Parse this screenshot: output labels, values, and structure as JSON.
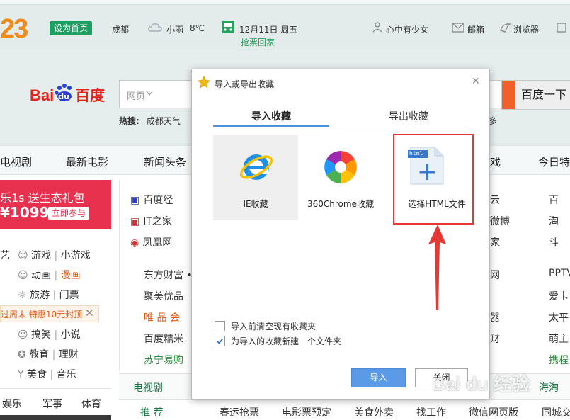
{
  "top": {
    "logo": "23",
    "set_homepage": "设为首页",
    "city": "成都",
    "weather": "小雨",
    "temp": "8℃",
    "date": "12月11日 周五",
    "ticket": "抢票回家",
    "user": "心中有少女",
    "mail": "邮箱",
    "browser": "浏览器"
  },
  "search": {
    "engine_bai": "Bai",
    "engine_du": "du",
    "engine_name": "百度",
    "type": "网页",
    "button": "百度一下",
    "hot_label": "热搜:",
    "hot_item": "成都天气",
    "hot_more": "多"
  },
  "nav": [
    "电视剧",
    "最新电影",
    "新闻头条",
    "戏",
    "今日特"
  ],
  "promo": {
    "line1": "乐1s 送生态礼包",
    "price": "¥1099",
    "cta": "立即参与"
  },
  "left": {
    "items": [
      {
        "a": "游戏",
        "b": "小游戏"
      },
      {
        "a": "动画",
        "b": "漫画"
      },
      {
        "a": "旅游",
        "b": "门票"
      },
      {
        "a": "搞笑",
        "b": "小说"
      },
      {
        "a": "教育",
        "b": "理财"
      },
      {
        "a": "美食",
        "b": "音乐"
      }
    ],
    "notice": "过周末 特惠10元封顶",
    "tabs": [
      "娱乐",
      "军事",
      "体育"
    ],
    "fragment": "艺"
  },
  "sites": {
    "left": [
      "百度经",
      "IT之家",
      "凤凰网",
      "东方财富 •",
      "聚美优品",
      "唯 品 会",
      "百度糯米",
      "苏宁易购"
    ],
    "mid": [
      "云",
      "微博",
      "家",
      "网",
      "器",
      "财"
    ],
    "right": [
      "百",
      "淘",
      "斗",
      "PPTV",
      "爱卡",
      "太平",
      "萌主",
      "携程"
    ],
    "tab": "电视剧",
    "tab_right": "海淘",
    "footer": [
      "推 荐",
      "春运抢票",
      "电影票预定",
      "美食外卖",
      "找工作",
      "微信网页版",
      "同城交"
    ]
  },
  "dialog": {
    "title": "导入或导出收藏",
    "tab_import": "导入收藏",
    "tab_export": "导出收藏",
    "opt_ie": "IE收藏",
    "opt_360": "360Chrome收藏",
    "opt_html": "选择HTML文件",
    "html_tag": "html",
    "chk1": "导入前清空现有收藏夹",
    "chk2": "为导入的收藏新建一个文件夹",
    "btn_import": "导入",
    "btn_close": "关闭"
  },
  "watermark": "Bai du 经验",
  "colors": {
    "accent": "#4c8fe0",
    "annotation": "#e53935",
    "green": "#1f9e63",
    "orange": "#f08a1a"
  }
}
